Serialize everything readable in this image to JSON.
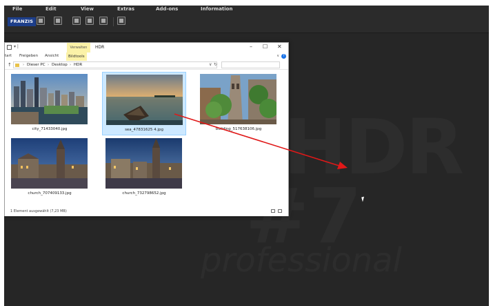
{
  "menu": {
    "items": [
      "File",
      "Edit",
      "View",
      "Extras",
      "Add-ons",
      "Information"
    ]
  },
  "toolbar": {
    "brand_label": "FRANZIS",
    "icons": [
      "open-file-icon",
      "camera-icon",
      "batch-icon",
      "gallery-icon",
      "clapper-icon",
      "layers-icon"
    ]
  },
  "watermark": {
    "hdr": "HDR",
    "number": "#7",
    "edition": "professional"
  },
  "explorer": {
    "context_tab": "Verwalten",
    "title": "HDR",
    "ribbon": {
      "tabs": [
        "tart",
        "Freigeben",
        "Ansicht",
        "Bildtools"
      ],
      "active_tab": "Bildtools",
      "help": "?"
    },
    "address": {
      "crumbs": [
        "Dieser PC",
        "Desktop",
        "HDR"
      ]
    },
    "files": [
      {
        "name": "city_71433040.jpg",
        "selected": false
      },
      {
        "name": "sea_47831625 4.jpg",
        "selected": true
      },
      {
        "name": "building_517638106.jpg",
        "selected": false
      },
      {
        "name": "church_707409133.jpg",
        "selected": false
      },
      {
        "name": "church_732798652.jpg",
        "selected": false
      }
    ],
    "status": "1 Element ausgewählt (7,23 MB)"
  },
  "colors": {
    "app_background": "#242424",
    "brand_blue": "#1d3e8a",
    "selection": "#cce8ff",
    "drag_arrow": "#e01818"
  }
}
